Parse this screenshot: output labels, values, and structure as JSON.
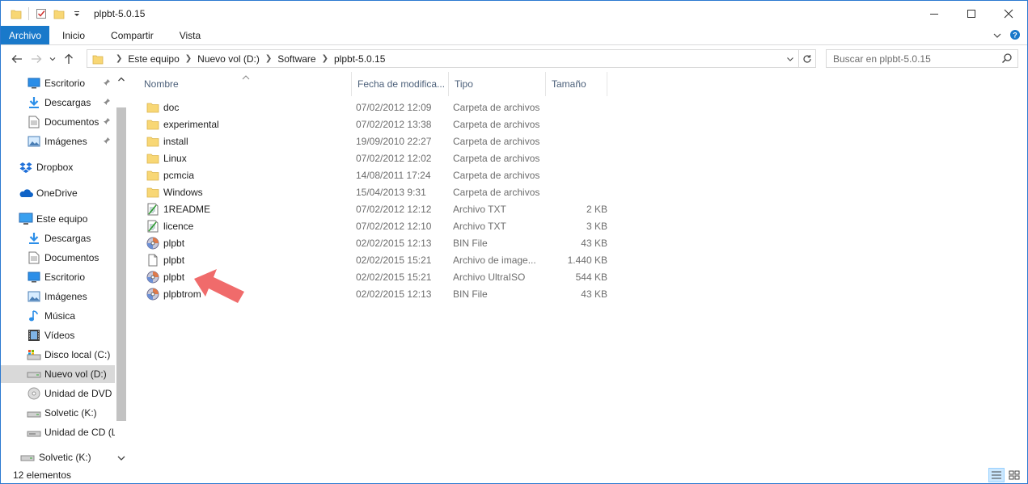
{
  "window": {
    "title": "plpbt-5.0.15"
  },
  "ribbon": {
    "tabs": [
      "Archivo",
      "Inicio",
      "Compartir",
      "Vista"
    ]
  },
  "address": {
    "crumbs": [
      "Este equipo",
      "Nuevo vol (D:)",
      "Software",
      "plpbt-5.0.15"
    ]
  },
  "search": {
    "placeholder": "Buscar en plpbt-5.0.15"
  },
  "nav": {
    "items": [
      {
        "label": "Escritorio",
        "icon": "desktop-icon",
        "pinned": true
      },
      {
        "label": "Descargas",
        "icon": "downloads-icon",
        "pinned": true
      },
      {
        "label": "Documentos",
        "icon": "documents-icon",
        "pinned": true
      },
      {
        "label": "Imágenes",
        "icon": "pictures-icon",
        "pinned": true
      },
      {
        "label": "Dropbox",
        "icon": "dropbox-icon"
      },
      {
        "label": "OneDrive",
        "icon": "onedrive-icon"
      },
      {
        "label": "Este equipo",
        "icon": "this-pc-icon"
      },
      {
        "label": "Descargas",
        "icon": "downloads-icon"
      },
      {
        "label": "Documentos",
        "icon": "documents-icon"
      },
      {
        "label": "Escritorio",
        "icon": "desktop-icon"
      },
      {
        "label": "Imágenes",
        "icon": "pictures-icon"
      },
      {
        "label": "Música",
        "icon": "music-icon"
      },
      {
        "label": "Vídeos",
        "icon": "videos-icon"
      },
      {
        "label": "Disco local (C:)",
        "icon": "local-disk-icon"
      },
      {
        "label": "Nuevo vol (D:)",
        "icon": "drive-icon",
        "selected": true
      },
      {
        "label": "Unidad de DVD R",
        "icon": "dvd-drive-icon"
      },
      {
        "label": "Solvetic (K:)",
        "icon": "drive-icon"
      },
      {
        "label": "Unidad de CD (L",
        "icon": "cd-drive-icon"
      }
    ],
    "bottom_item": "Solvetic (K:)"
  },
  "columns": {
    "name": "Nombre",
    "date": "Fecha de modifica...",
    "type": "Tipo",
    "size": "Tamaño"
  },
  "files": [
    {
      "name": "doc",
      "date": "07/02/2012 12:09",
      "type": "Carpeta de archivos",
      "size": "",
      "icon": "folder-icon"
    },
    {
      "name": "experimental",
      "date": "07/02/2012 13:38",
      "type": "Carpeta de archivos",
      "size": "",
      "icon": "folder-icon"
    },
    {
      "name": "install",
      "date": "19/09/2010 22:27",
      "type": "Carpeta de archivos",
      "size": "",
      "icon": "folder-icon"
    },
    {
      "name": "Linux",
      "date": "07/02/2012 12:02",
      "type": "Carpeta de archivos",
      "size": "",
      "icon": "folder-icon"
    },
    {
      "name": "pcmcia",
      "date": "14/08/2011 17:24",
      "type": "Carpeta de archivos",
      "size": "",
      "icon": "folder-icon"
    },
    {
      "name": "Windows",
      "date": "15/04/2013 9:31",
      "type": "Carpeta de archivos",
      "size": "",
      "icon": "folder-icon"
    },
    {
      "name": "1README",
      "date": "07/02/2012 12:12",
      "type": "Archivo TXT",
      "size": "2 KB",
      "icon": "text-file-icon"
    },
    {
      "name": "licence",
      "date": "07/02/2012 12:10",
      "type": "Archivo TXT",
      "size": "3 KB",
      "icon": "text-file-icon"
    },
    {
      "name": "plpbt",
      "date": "02/02/2015 12:13",
      "type": "BIN File",
      "size": "43 KB",
      "icon": "disc-file-icon"
    },
    {
      "name": "plpbt",
      "date": "02/02/2015 15:21",
      "type": "Archivo de image...",
      "size": "1.440 KB",
      "icon": "blank-file-icon"
    },
    {
      "name": "plpbt",
      "date": "02/02/2015 15:21",
      "type": "Archivo UltraISO",
      "size": "544 KB",
      "icon": "disc-file-icon"
    },
    {
      "name": "plpbtrom",
      "date": "02/02/2015 12:13",
      "type": "BIN File",
      "size": "43 KB",
      "icon": "disc-file-icon"
    }
  ],
  "status": {
    "count": "12 elementos"
  },
  "colors": {
    "accent": "#1979ca",
    "selected_nav": "#d9d9d9",
    "folder": "#f8d775",
    "arrow": "#f06b6b"
  }
}
